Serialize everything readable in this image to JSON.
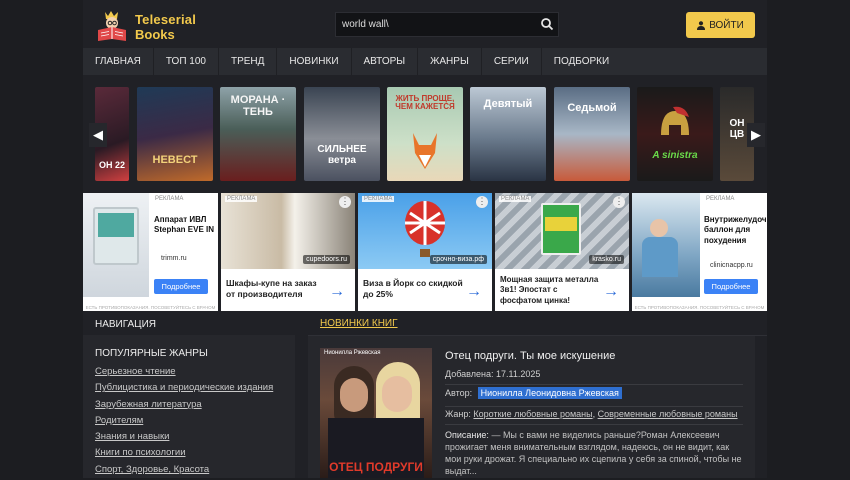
{
  "brand": {
    "line1": "Teleserial",
    "line2": "Books",
    "accent": "#f2c94c"
  },
  "search": {
    "value": "world wall\\",
    "placeholder": ""
  },
  "login": {
    "label": "ВОЙТИ"
  },
  "nav": [
    "ГЛАВНАЯ",
    "ТОП 100",
    "ТРЕНД",
    "НОВИНКИ",
    "АВТОРЫ",
    "ЖАНРЫ",
    "СЕРИИ",
    "ПОДБОРКИ"
  ],
  "carousel": {
    "books": [
      {
        "text": "ОН 22"
      },
      {
        "text": "НЕВЕСТ"
      },
      {
        "text": "МОРАНА · ТЕНЬ"
      },
      {
        "text": "СИЛЬНЕЕ ветра"
      },
      {
        "text": "ЖИТЬ ПРОЩЕ, ЧЕМ КАЖЕТСЯ"
      },
      {
        "text": "Девятый"
      },
      {
        "text": "Седьмой"
      },
      {
        "text": "A sinistra"
      },
      {
        "text": "ОН ЦВ"
      }
    ],
    "prev_icon": "chevron-left-icon",
    "next_icon": "chevron-right-icon"
  },
  "ads": {
    "tag": "РЕКЛАМА",
    "fine": "ЕСТЬ ПРОТИВОПОКАЗАНИЯ. ПОСОВЕТУЙТЕСЬ С ВРАЧОМ",
    "more": "Подробнее",
    "items": [
      {
        "title": "Аппарат ИВЛ Stephan EVE IN",
        "domain": "trimm.ru"
      },
      {
        "title": "Шкафы-купе на заказ от производителя",
        "domain": "cupedoors.ru"
      },
      {
        "title": "Виза в Йорк со скидкой до 25%",
        "domain": "срочно-виза.рф"
      },
      {
        "title": "Мощная защита металла 3в1! Эпостат с фосфатом цинка!",
        "domain": "krasko.ru"
      },
      {
        "title": "Внутрижелудочный баллон для похудения",
        "domain": "clinicnacpp.ru"
      }
    ]
  },
  "sidebar": {
    "title": "НАВИГАЦИЯ",
    "subtitle": "ПОПУЛЯРНЫЕ ЖАНРЫ",
    "genres": [
      "Серьезное чтение",
      "Публицистика и периодические издания",
      "Зарубежная литература",
      "Родителям",
      "Знания и навыки",
      "Книги по психологии",
      "Спорт, Здоровье, Красота"
    ]
  },
  "main": {
    "tab": "НОВИНКИ КНИГ",
    "book": {
      "cover_text": "ОТЕЦ ПОДРУГИ",
      "cover_author": "Нионилла Ржевская",
      "title": "Отец подруги. Ты мое искушение",
      "added_label": "Добавлена:",
      "added_value": "17.11.2025",
      "author_label": "Автор:",
      "author_value": "Нионилла Леонидовна Ржевская",
      "genre_label": "Жанр:",
      "genres": [
        "Короткие любовные романы",
        "Современные любовные романы"
      ],
      "desc_label": "Описание:",
      "desc": "— Мы с вами не виделись раньше?Роман Алексеевич прожигает меня внимательным взглядом, надеюсь, он не видит, как мои руки дрожат. Я специально их сцепила у себя за спиной, чтобы не выдат..."
    }
  }
}
